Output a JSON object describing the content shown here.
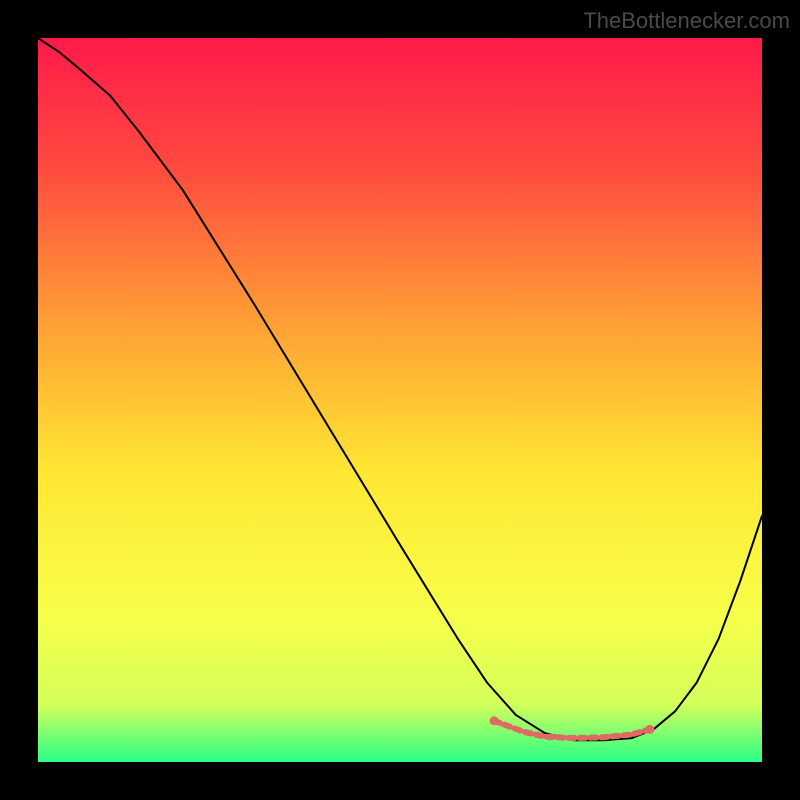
{
  "watermark": "TheBottlenecker.com",
  "chart_data": {
    "type": "line",
    "title": "",
    "xlabel": "",
    "ylabel": "",
    "xlim": [
      0,
      100
    ],
    "ylim": [
      0,
      100
    ],
    "gradient_stops": [
      {
        "offset": 0,
        "color": "#ff1a4a"
      },
      {
        "offset": 18,
        "color": "#ff4a3f"
      },
      {
        "offset": 40,
        "color": "#ffa235"
      },
      {
        "offset": 60,
        "color": "#ffe733"
      },
      {
        "offset": 80,
        "color": "#f7ff4a"
      },
      {
        "offset": 92,
        "color": "#d4ff5a"
      },
      {
        "offset": 100,
        "color": "#2aff88"
      }
    ],
    "series": [
      {
        "name": "bottleneck-curve",
        "color": "#000000",
        "width": 2,
        "x": [
          0,
          3,
          6,
          10,
          14,
          20,
          30,
          40,
          50,
          58,
          62,
          66,
          70,
          74,
          78,
          82,
          85,
          88,
          91,
          94,
          97,
          100
        ],
        "y": [
          100,
          98,
          95.5,
          92,
          87,
          79,
          63,
          46.5,
          30,
          17,
          11,
          6.5,
          4,
          3,
          3,
          3.3,
          4.5,
          7,
          11,
          17,
          25,
          34
        ]
      },
      {
        "name": "flat-zone-marker",
        "color": "#e06a63",
        "width": 6,
        "dash": "6,5",
        "x": [
          63,
          67,
          70,
          74,
          78,
          82,
          84.5
        ],
        "y": [
          5.7,
          4.2,
          3.5,
          3.3,
          3.4,
          3.8,
          4.5
        ]
      }
    ],
    "flat_zone_endcaps": [
      {
        "x": 63,
        "y": 5.7
      },
      {
        "x": 84.5,
        "y": 4.5
      }
    ]
  }
}
